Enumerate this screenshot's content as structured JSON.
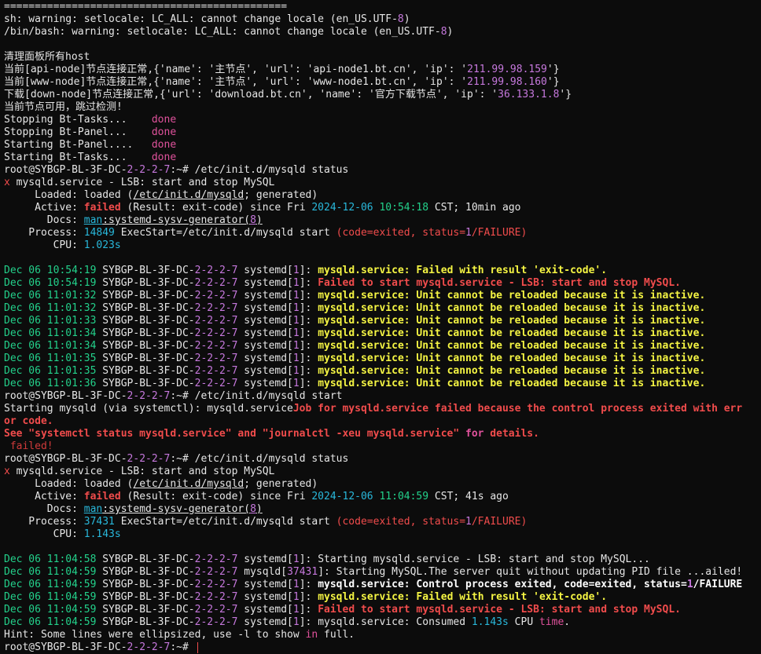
{
  "separator": "==============================================",
  "lines": {
    "warn1_a": "sh: warning: setlocale: LC_ALL: cannot change locale (en_US.UTF-",
    "warn1_b": "8",
    "warn1_c": ")",
    "warn2_a": "/bin/bash: warning: setlocale: LC_ALL: cannot change locale (en_US.UTF-",
    "warn2_b": "8",
    "warn2_c": ")",
    "cn_clear": "清理面板所有host",
    "node1_a": "当前[api-node]节点连接正常,{'name': '主节点', 'url': 'api-node1.bt.cn', 'ip': '",
    "node1_ip": "211.99.98.159",
    "node1_c": "'}",
    "node2_a": "当前[www-node]节点连接正常,{'name': '主节点', 'url': 'www-node1.bt.cn', 'ip': '",
    "node2_ip": "211.99.98.160",
    "node2_c": "'}",
    "node3_a": "下载[down-node]节点连接正常,{'url': 'download.bt.cn', 'name': '官方下载节点', 'ip': '",
    "node3_ip": "36.133.1.8",
    "node3_c": "'}",
    "cn_skip": "当前节点可用，跳过检测!",
    "svc": [
      {
        "label": "Stopping Bt-Tasks...    ",
        "status": "done"
      },
      {
        "label": "Stopping Bt-Panel...    ",
        "status": "done"
      },
      {
        "label": "Starting Bt-Panel....   ",
        "status": "done"
      },
      {
        "label": "Starting Bt-Tasks...    ",
        "status": "done"
      }
    ]
  },
  "prompt": {
    "host_a": "root@SYBGP-BL-3F-DC-",
    "host_nums": "2-2-2-7",
    "host_b": ":~# "
  },
  "status1": {
    "cmd": "/etc/init.d/mysqld status",
    "x": "x",
    "title": " mysqld.service - LSB: start and stop MySQL",
    "loaded_lbl": "     Loaded: ",
    "loaded_val_a": "loaded (",
    "loaded_path": "/etc/init.d/mysqld",
    "loaded_val_b": "; generated)",
    "active_lbl": "     Active: ",
    "active_state": "failed",
    "active_mid": " (Result: exit-code) since Fri ",
    "active_date": "2024-12-06",
    "active_time": "10:54:18",
    "active_tail": " CST; 10min ago",
    "docs_lbl": "       Docs: ",
    "docs_man": "man",
    "docs_val": ":systemd-sysv-generator(",
    "docs_num": "8",
    "docs_close": ")",
    "proc_lbl": "    Process: ",
    "proc_pid": "14849",
    "proc_mid": " ExecStart=/etc/init.d/mysqld start ",
    "proc_code_a": "(code=exited, status=",
    "proc_code_num": "1",
    "proc_code_b": "/FAILURE)",
    "cpu_lbl": "        CPU: ",
    "cpu_val": "1.023s"
  },
  "log1": [
    {
      "date": "Dec 06 10:54:19",
      "unit": " systemd[",
      "num": "1",
      "close": "]: ",
      "msg": "mysqld.service: Failed with result 'exit-code'.",
      "kind": "yel"
    },
    {
      "date": "Dec 06 10:54:19",
      "unit": " systemd[",
      "num": "1",
      "close": "]: ",
      "msg": "Failed to start mysqld.service - LSB: start and stop MySQL.",
      "kind": "red"
    },
    {
      "date": "Dec 06 11:01:32",
      "unit": " systemd[",
      "num": "1",
      "close": "]: ",
      "msg": "mysqld.service: Unit cannot be reloaded because it is inactive.",
      "kind": "yel"
    },
    {
      "date": "Dec 06 11:01:32",
      "unit": " systemd[",
      "num": "1",
      "close": "]: ",
      "msg": "mysqld.service: Unit cannot be reloaded because it is inactive.",
      "kind": "yel"
    },
    {
      "date": "Dec 06 11:01:33",
      "unit": " systemd[",
      "num": "1",
      "close": "]: ",
      "msg": "mysqld.service: Unit cannot be reloaded because it is inactive.",
      "kind": "yel"
    },
    {
      "date": "Dec 06 11:01:34",
      "unit": " systemd[",
      "num": "1",
      "close": "]: ",
      "msg": "mysqld.service: Unit cannot be reloaded because it is inactive.",
      "kind": "yel"
    },
    {
      "date": "Dec 06 11:01:34",
      "unit": " systemd[",
      "num": "1",
      "close": "]: ",
      "msg": "mysqld.service: Unit cannot be reloaded because it is inactive.",
      "kind": "yel"
    },
    {
      "date": "Dec 06 11:01:35",
      "unit": " systemd[",
      "num": "1",
      "close": "]: ",
      "msg": "mysqld.service: Unit cannot be reloaded because it is inactive.",
      "kind": "yel"
    },
    {
      "date": "Dec 06 11:01:35",
      "unit": " systemd[",
      "num": "1",
      "close": "]: ",
      "msg": "mysqld.service: Unit cannot be reloaded because it is inactive.",
      "kind": "yel"
    },
    {
      "date": "Dec 06 11:01:36",
      "unit": " systemd[",
      "num": "1",
      "close": "]: ",
      "msg": "mysqld.service: Unit cannot be reloaded because it is inactive.",
      "kind": "yel"
    }
  ],
  "start": {
    "cmd": "/etc/init.d/mysqld start",
    "out_a": "Starting mysqld (via systemctl): mysqld.service",
    "out_err1": "Job for mysqld.service failed because the control process exited with err",
    "out_err2": "or code.",
    "out_err3_a": "See \"systemctl status mysqld.service\" and \"journalctl -xeu mysqld.service\" ",
    "out_err3_for": "for",
    "out_err3_b": " details.",
    "failed": " failed!"
  },
  "status2": {
    "cmd": "/etc/init.d/mysqld status",
    "x": "x",
    "title": " mysqld.service - LSB: start and stop MySQL",
    "loaded_lbl": "     Loaded: ",
    "loaded_val_a": "loaded (",
    "loaded_path": "/etc/init.d/mysqld",
    "loaded_val_b": "; generated)",
    "active_lbl": "     Active: ",
    "active_state": "failed",
    "active_mid": " (Result: exit-code) since Fri ",
    "active_date": "2024-12-06",
    "active_time": "11:04:59",
    "active_tail": " CST; 41s ago",
    "docs_lbl": "       Docs: ",
    "docs_man": "man",
    "docs_val": ":systemd-sysv-generator(",
    "docs_num": "8",
    "docs_close": ")",
    "proc_lbl": "    Process: ",
    "proc_pid": "37431",
    "proc_mid": " ExecStart=/etc/init.d/mysqld start ",
    "proc_code_a": "(code=exited, status=",
    "proc_code_num": "1",
    "proc_code_b": "/FAILURE)",
    "cpu_lbl": "        CPU: ",
    "cpu_val": "1.143s"
  },
  "log2": {
    "l1": {
      "date": "Dec 06 11:04:58",
      "pre": " systemd[",
      "num": "1",
      "close": "]: ",
      "msg": "Starting mysqld.service - LSB: start and stop MySQL..."
    },
    "l2": {
      "date": "Dec 06 11:04:59",
      "pre": " mysqld[",
      "num": "37431",
      "close": "]: ",
      "msg": "Starting MySQL.The server quit without updating PID file ...ailed!"
    },
    "l3": {
      "date": "Dec 06 11:04:59",
      "pre": " systemd[",
      "num": "1",
      "close": "]: ",
      "msg_a": "mysqld.service: Control process exited, code=exited, status=",
      "msg_num": "1",
      "msg_b": "/FAILURE"
    },
    "l4": {
      "date": "Dec 06 11:04:59",
      "pre": " systemd[",
      "num": "1",
      "close": "]: ",
      "msg": "mysqld.service: Failed with result 'exit-code'."
    },
    "l5": {
      "date": "Dec 06 11:04:59",
      "pre": " systemd[",
      "num": "1",
      "close": "]: ",
      "msg": "Failed to start mysqld.service - LSB: start and stop MySQL."
    },
    "l6": {
      "date": "Dec 06 11:04:59",
      "pre": " systemd[",
      "num": "1",
      "close": "]: ",
      "msg_a": "mysqld.service: Consumed ",
      "msg_num": "1.143s",
      "msg_mid": " CPU ",
      "msg_time": "time",
      "msg_b": "."
    }
  },
  "hint": {
    "a": "Hint: Some lines were ellipsized, use -l to show ",
    "in": "in",
    "b": " full."
  }
}
